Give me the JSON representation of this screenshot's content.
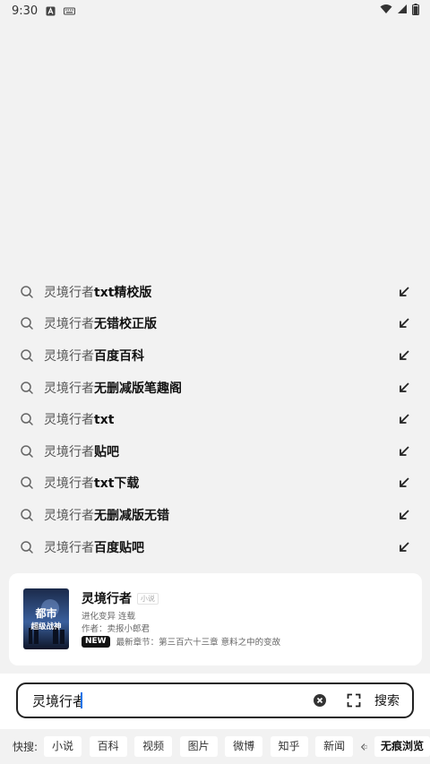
{
  "status": {
    "time": "9:30",
    "icons": [
      "a-icon",
      "keyboard-icon",
      "wifi-icon",
      "signal-icon",
      "battery-icon"
    ]
  },
  "suggestions": [
    {
      "prefix": "灵境行者",
      "highlight": "txt精校版"
    },
    {
      "prefix": "灵境行者",
      "highlight": "无错校正版"
    },
    {
      "prefix": "灵境行者",
      "highlight": "百度百科"
    },
    {
      "prefix": "灵境行者",
      "highlight": "无删减版笔趣阁"
    },
    {
      "prefix": "灵境行者",
      "highlight": "txt"
    },
    {
      "prefix": "灵境行者",
      "highlight": "贴吧"
    },
    {
      "prefix": "灵境行者",
      "highlight": "txt下载"
    },
    {
      "prefix": "灵境行者",
      "highlight": "无删减版无错"
    },
    {
      "prefix": "灵境行者",
      "highlight": "百度贴吧"
    }
  ],
  "book_card": {
    "title": "灵境行者",
    "tag": "小说",
    "genre_status": "进化变异 连载",
    "author": "作者：卖报小郎君",
    "new_badge": "NEW",
    "latest": "最新章节：第三百六十三章 意料之中的变故",
    "cover_text_1": "都市",
    "cover_text_2": "超级战神"
  },
  "search": {
    "value": "灵境行者",
    "button_label": "搜索"
  },
  "quick": {
    "label": "快搜:",
    "chips": [
      "小说",
      "百科",
      "视频",
      "图片",
      "微博",
      "知乎",
      "新闻"
    ],
    "incognito_label": "无痕浏览"
  },
  "colors": {
    "background": "#f2f2f2",
    "caret": "#1a73e8",
    "badge": "#111111"
  }
}
